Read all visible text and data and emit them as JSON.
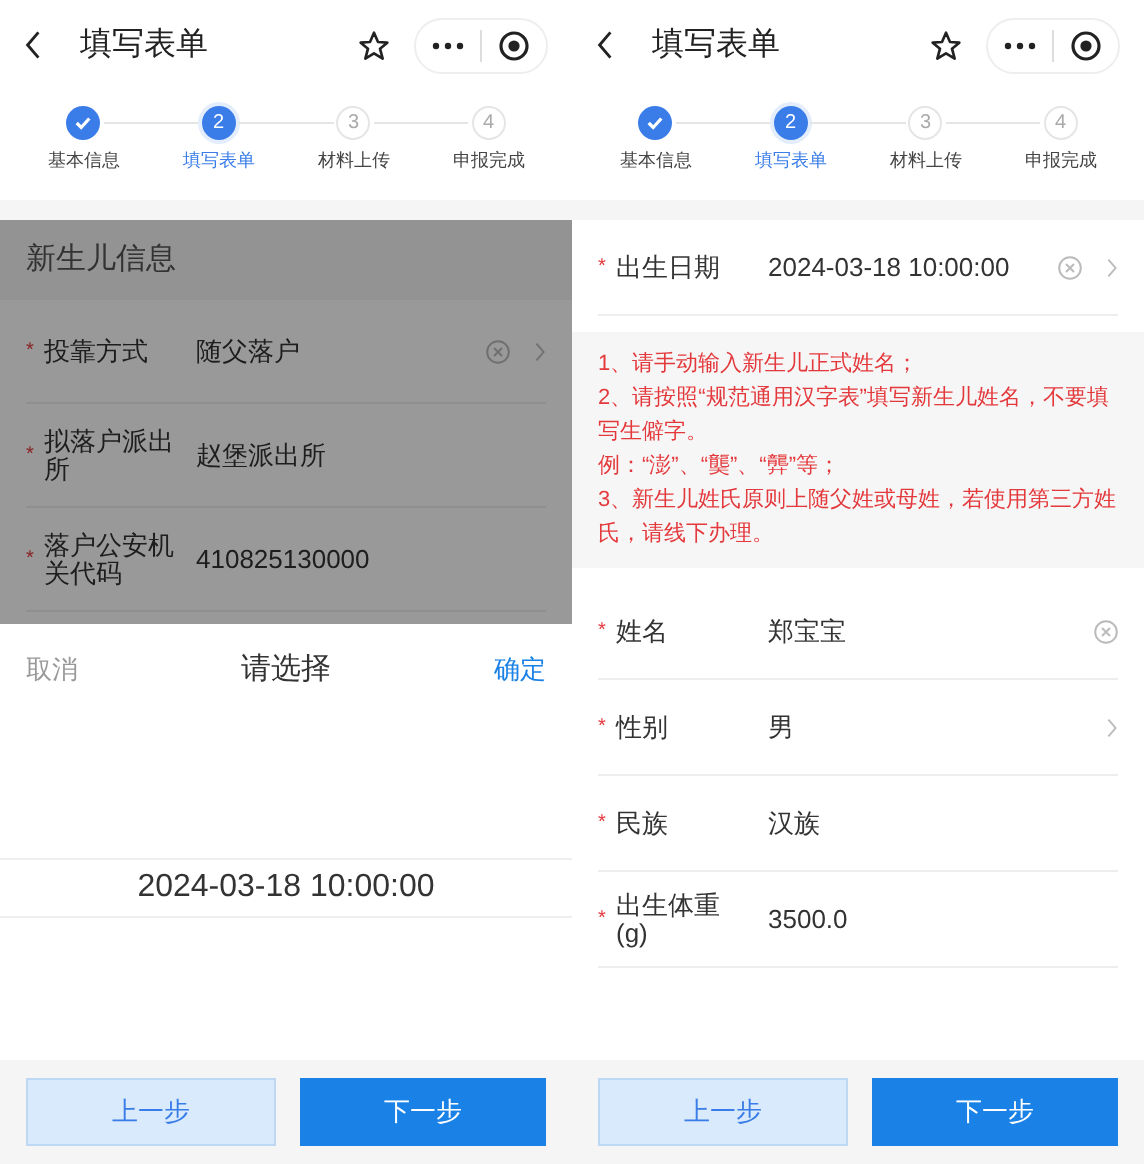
{
  "screens": [
    {
      "title": "填写表单",
      "steps": [
        {
          "label": "基本信息",
          "done": true,
          "selected": false
        },
        {
          "number": "2",
          "label": "填写表单",
          "done": false,
          "selected": true
        },
        {
          "number": "3",
          "label": "材料上传",
          "done": false,
          "selected": false
        },
        {
          "number": "4",
          "label": "申报完成",
          "done": false,
          "selected": false
        }
      ],
      "dimmed": true,
      "section_title": "新生儿信息",
      "items": [
        {
          "kind": "field",
          "required_mark": "*",
          "label": "投靠方式",
          "value": "随父落户",
          "clearable": true,
          "arrow": true
        },
        {
          "kind": "field",
          "required_mark": "*",
          "label": "拟落户派出所",
          "value": "赵堡派出所",
          "clearable": false,
          "arrow": false
        },
        {
          "kind": "field",
          "required_mark": "*",
          "label": "落户公安机关代码",
          "value": "410825130000",
          "clearable": false,
          "arrow": false
        }
      ],
      "picker": {
        "cancel": "取消",
        "title": "请选择",
        "confirm": "确定",
        "value": "2024-03-18 10:00:00"
      },
      "buttons": {
        "prev": "上一步",
        "next": "下一步"
      }
    },
    {
      "title": "填写表单",
      "steps": [
        {
          "label": "基本信息",
          "done": true,
          "selected": false
        },
        {
          "number": "2",
          "label": "填写表单",
          "done": false,
          "selected": true
        },
        {
          "number": "3",
          "label": "材料上传",
          "done": false,
          "selected": false
        },
        {
          "number": "4",
          "label": "申报完成",
          "done": false,
          "selected": false
        }
      ],
      "dimmed": false,
      "items": [
        {
          "kind": "field",
          "required_mark": "*",
          "label": "出生日期",
          "value": "2024-03-18 10:00:00",
          "clearable": true,
          "arrow": true
        },
        {
          "kind": "notice",
          "lines": [
            "1、请手动输入新生儿正式姓名；",
            "2、请按照“规范通用汉字表”填写新生儿姓名，不要填写生僻字。",
            "例：“澎”、“龑”、“龏”等；",
            "3、新生儿姓氏原则上随父姓或母姓，若使用第三方姓氏，请线下办理。"
          ]
        },
        {
          "kind": "field",
          "required_mark": "*",
          "label": "姓名",
          "value": "郑宝宝",
          "clearable": true,
          "arrow": false
        },
        {
          "kind": "field",
          "required_mark": "*",
          "label": "性别",
          "value": "男",
          "clearable": false,
          "arrow": true
        },
        {
          "kind": "field",
          "required_mark": "*",
          "label": "民族",
          "value": "汉族",
          "clearable": false,
          "arrow": false
        },
        {
          "kind": "field",
          "required_mark": "*",
          "label": "出生体重(g)",
          "value": "3500.0",
          "clearable": false,
          "arrow": false
        }
      ],
      "buttons": {
        "prev": "上一步",
        "next": "下一步"
      }
    }
  ]
}
